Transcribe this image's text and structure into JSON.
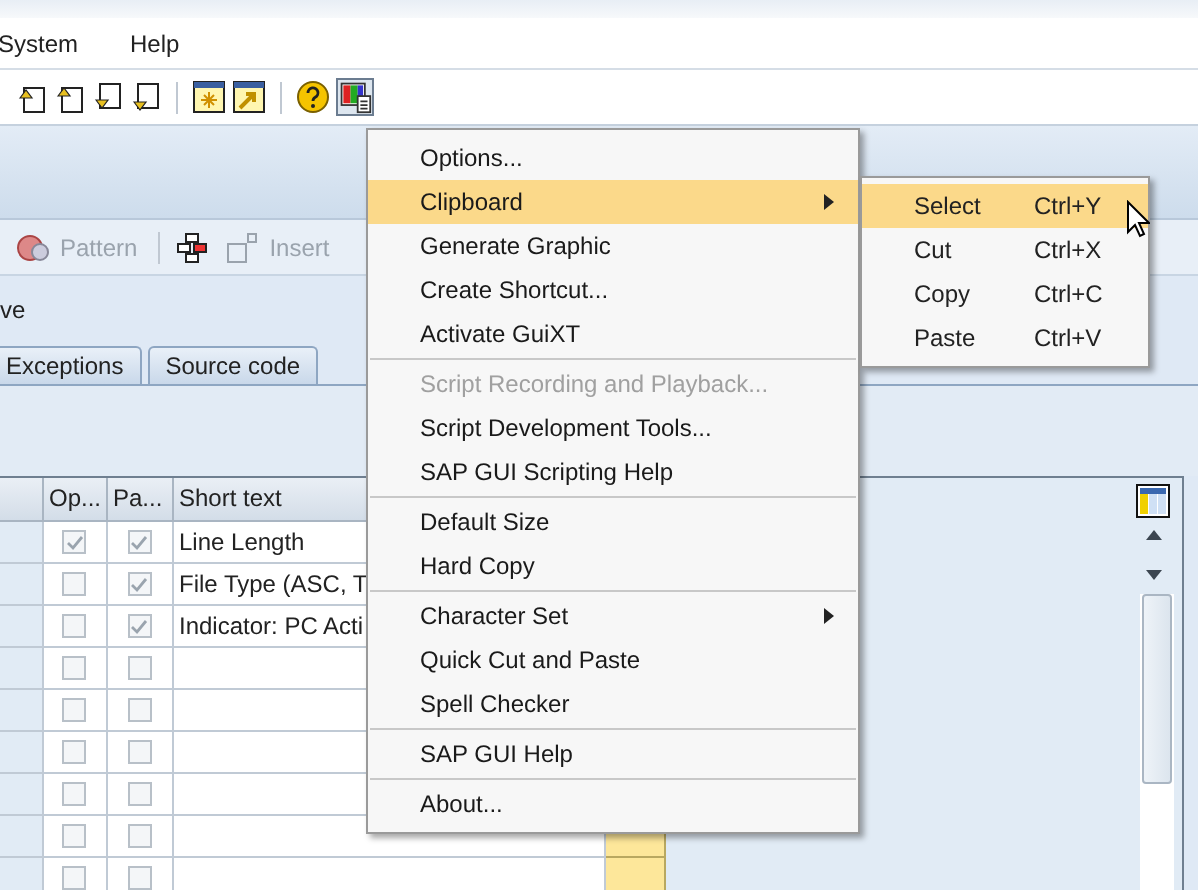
{
  "menu_bar": [
    "System",
    "Help"
  ],
  "app_toolbar": [
    {
      "label": "Pattern",
      "disabled": true
    },
    {
      "label": "Insert",
      "disabled": true
    }
  ],
  "section_label": "ve",
  "tabs": [
    {
      "label": "Exceptions",
      "selected": false
    },
    {
      "label": "Source code",
      "selected": false
    }
  ],
  "table": {
    "columns": [
      "Op...",
      "Pa...",
      "Short text"
    ],
    "rows": [
      {
        "op_checked": true,
        "pa_checked": true,
        "short_text": "Line Length"
      },
      {
        "op_checked": false,
        "pa_checked": true,
        "short_text": "File Type (ASC, T"
      },
      {
        "op_checked": false,
        "pa_checked": true,
        "short_text": "Indicator: PC Acti"
      },
      {
        "op_checked": false,
        "pa_checked": false
      },
      {
        "op_checked": false,
        "pa_checked": false
      },
      {
        "op_checked": false,
        "pa_checked": false
      },
      {
        "op_checked": false,
        "pa_checked": false
      },
      {
        "op_checked": false,
        "pa_checked": false
      },
      {
        "op_checked": false,
        "pa_checked": false
      }
    ]
  },
  "menu": [
    {
      "kind": "item",
      "label": "Options...",
      "selected": false
    },
    {
      "kind": "item",
      "label": "Clipboard",
      "selected": true,
      "submenu": true
    },
    {
      "kind": "item",
      "label": "Generate Graphic",
      "selected": false
    },
    {
      "kind": "item",
      "label": "Create Shortcut...",
      "selected": false
    },
    {
      "kind": "item",
      "label": "Activate GuiXT",
      "selected": false
    },
    {
      "kind": "separator"
    },
    {
      "kind": "item",
      "label": "Script Recording and Playback...",
      "selected": false,
      "disabled": true
    },
    {
      "kind": "item",
      "label": "Script Development Tools...",
      "selected": false
    },
    {
      "kind": "item",
      "label": "SAP GUI Scripting Help",
      "selected": false
    },
    {
      "kind": "separator"
    },
    {
      "kind": "item",
      "label": "Default Size",
      "selected": false
    },
    {
      "kind": "item",
      "label": "Hard Copy",
      "selected": false
    },
    {
      "kind": "separator"
    },
    {
      "kind": "item",
      "label": "Character Set",
      "selected": false,
      "submenu": true
    },
    {
      "kind": "item",
      "label": "Quick Cut and Paste",
      "selected": false
    },
    {
      "kind": "item",
      "label": "Spell Checker",
      "selected": false
    },
    {
      "kind": "separator"
    },
    {
      "kind": "item",
      "label": "SAP GUI Help",
      "selected": false
    },
    {
      "kind": "separator"
    },
    {
      "kind": "item",
      "label": "About...",
      "selected": false
    }
  ],
  "submenu": [
    {
      "label": "Select",
      "shortcut": "Ctrl+Y",
      "selected": true
    },
    {
      "label": "Cut",
      "shortcut": "Ctrl+X",
      "selected": false
    },
    {
      "label": "Copy",
      "shortcut": "Ctrl+C",
      "selected": false
    },
    {
      "label": "Paste",
      "shortcut": "Ctrl+V",
      "selected": false
    }
  ]
}
